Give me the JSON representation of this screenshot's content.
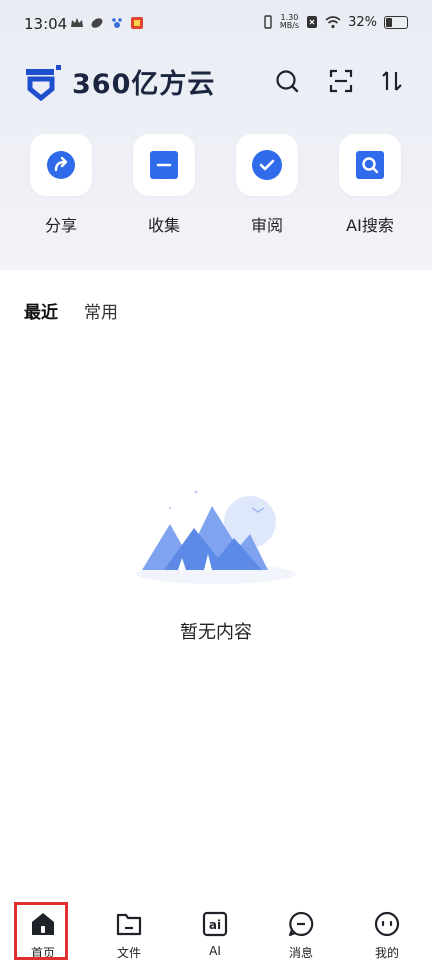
{
  "status_bar": {
    "time": "13:04",
    "net_speed_value": "1.30",
    "net_speed_unit": "MB/s",
    "battery": "32%"
  },
  "header": {
    "brand": "360亿方云",
    "icons": [
      "search-icon",
      "scan-icon",
      "sort-icon"
    ]
  },
  "quick_actions": [
    {
      "label": "分享",
      "icon": "share-icon"
    },
    {
      "label": "收集",
      "icon": "collect-icon"
    },
    {
      "label": "审阅",
      "icon": "review-icon"
    },
    {
      "label": "AI搜索",
      "icon": "ai-search-icon"
    }
  ],
  "tabs": {
    "recent": "最近",
    "frequent": "常用",
    "active": "最近"
  },
  "empty_state": {
    "text": "暂无内容"
  },
  "bottom_nav": [
    {
      "label": "首页",
      "icon": "home-icon",
      "active": true
    },
    {
      "label": "文件",
      "icon": "folder-icon"
    },
    {
      "label": "AI",
      "icon": "ai-icon",
      "icon_text": "ai"
    },
    {
      "label": "消息",
      "icon": "message-icon"
    },
    {
      "label": "我的",
      "icon": "profile-icon"
    }
  ],
  "colors": {
    "accent": "#2f6bea",
    "highlight": "#e03030",
    "text": "#1f2329"
  }
}
